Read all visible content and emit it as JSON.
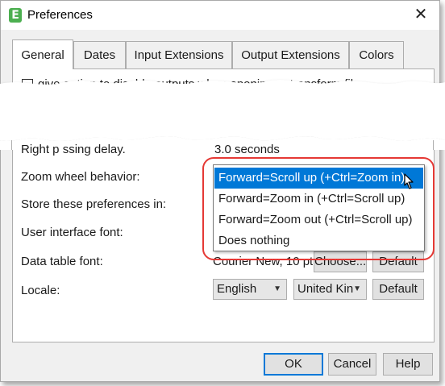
{
  "window": {
    "title": "Preferences",
    "app_icon_letter": "E",
    "close_glyph": "✕"
  },
  "tabs": [
    {
      "label": "General",
      "active": true
    },
    {
      "label": "Dates",
      "active": false
    },
    {
      "label": "Input Extensions",
      "active": false
    },
    {
      "label": "Output Extensions",
      "active": false
    },
    {
      "label": "Colors",
      "active": false
    }
  ],
  "general": {
    "checkbox_label_partial": "give option to disable outputs when opening a .transform file",
    "right_processing_delay": {
      "label": "Right p   ssing delay.",
      "value": "3.0 seconds"
    },
    "zoom_wheel": {
      "label": "Zoom wheel behavior:",
      "selected": "Forward=Scroll up (+Ctrl=Zoom in)",
      "options": [
        "Forward=Scroll up (+Ctrl=Zoom in)",
        "Forward=Zoom in (+Ctrl=Scroll up)",
        "Forward=Zoom out (+Ctrl=Scroll up)",
        "Does nothing"
      ]
    },
    "store_preferences": {
      "label": "Store these preferences in:"
    },
    "ui_font": {
      "label": "User interface font:"
    },
    "data_table_font": {
      "label": "Data table font:",
      "value": "Courier New, 10 pt",
      "choose_label": "Choose...",
      "default_label": "Default"
    },
    "locale": {
      "label": "Locale:",
      "language": "English",
      "region": "United Kin",
      "default_label": "Default"
    }
  },
  "footer": {
    "ok_label": "OK",
    "cancel_label": "Cancel",
    "help_label": "Help"
  },
  "colors": {
    "accent": "#0078d7",
    "highlight_ring": "#e53935",
    "app_icon": "#4caf50"
  },
  "icons": [
    "app-icon",
    "close-icon",
    "dropdown-arrow-icon",
    "mouse-cursor-icon"
  ]
}
